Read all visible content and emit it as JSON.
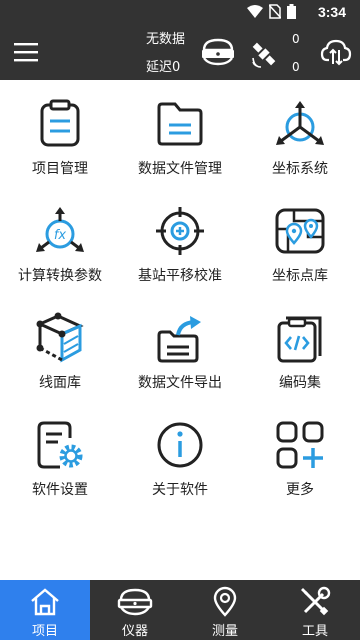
{
  "status_bar": {
    "time": "3:34"
  },
  "header": {
    "status_line1": "无数据",
    "status_line2": "延迟0",
    "count_top": "0",
    "count_bottom": "0"
  },
  "grid": {
    "items": [
      {
        "label": "项目管理"
      },
      {
        "label": "数据文件管理"
      },
      {
        "label": "坐标系统"
      },
      {
        "label": "计算转换参数"
      },
      {
        "label": "基站平移校准"
      },
      {
        "label": "坐标点库"
      },
      {
        "label": "线面库"
      },
      {
        "label": "数据文件导出"
      },
      {
        "label": "编码集"
      },
      {
        "label": "软件设置"
      },
      {
        "label": "关于软件"
      },
      {
        "label": "更多"
      }
    ]
  },
  "bottom_nav": {
    "tabs": [
      {
        "label": "项目",
        "active": true
      },
      {
        "label": "仪器",
        "active": false
      },
      {
        "label": "测量",
        "active": false
      },
      {
        "label": "工具",
        "active": false
      }
    ]
  },
  "colors": {
    "accent": "#2f80ed",
    "dark": "#333333",
    "icon_blue": "#2b9ce0"
  }
}
